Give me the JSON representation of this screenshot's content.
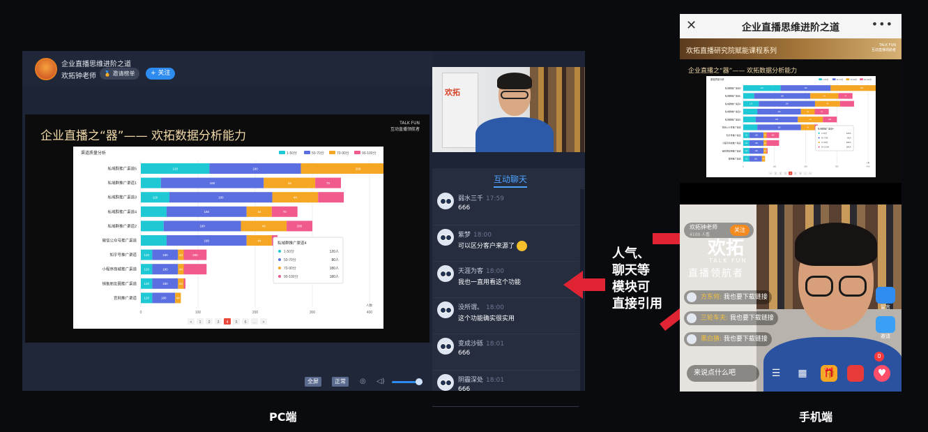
{
  "pc": {
    "course_title": "企业直播思维进阶之道",
    "teacher": "欢拓钟老师",
    "invite_label": "邀请榜单",
    "follow_label": "+ 关注",
    "slide_title": "企业直播之“器”—— 欢拓数据分析能力",
    "slide_logo_line1": "TALK FUN",
    "slide_logo_line2": "互动直播领航者",
    "controls": {
      "fullscreen": "全屏",
      "normal": "正常"
    },
    "chat_tab": "互动聊天",
    "chat": [
      {
        "name": "弱水三千",
        "time": "17:59",
        "text": "666"
      },
      {
        "name": "紫梦",
        "time": "18:00",
        "text": "可以区分客户来源了"
      },
      {
        "name": "天涯为客",
        "time": "18:00",
        "text": "我也一直用看这个功能"
      },
      {
        "name": "没所谓。",
        "time": "18:00",
        "text": "这个功能确实很实用"
      },
      {
        "name": "变成沙砾",
        "time": "18:01",
        "text": "666"
      },
      {
        "name": "阴霾深处",
        "time": "18:01",
        "text": "666"
      }
    ],
    "camera_logo": "欢拓"
  },
  "chart_data": {
    "type": "bar",
    "orientation": "horizontal",
    "stacked": true,
    "title": "渠道质量分析",
    "categories": [
      "私域群推广渠道5",
      "私域群推广渠道1",
      "私域群推广渠道3",
      "私域群推广渠道4",
      "私域群推广渠道2",
      "微信公众号推广渠道",
      "知乎号推广渠道",
      "小程序商城推广渠道",
      "销售朋友圈推广渠道",
      "官网推广渠道"
    ],
    "series": [
      {
        "name": "1-50分",
        "color": "#1ec8d4",
        "values": [
          120,
          35,
          50,
          45,
          40,
          45,
          20,
          20,
          20,
          20
        ],
        "labels": [
          "120",
          "",
          "120",
          "",
          "",
          "",
          "120",
          "120",
          "120",
          "120"
        ]
      },
      {
        "name": "50-70分",
        "color": "#5b6fe0",
        "values": [
          160,
          180,
          180,
          140,
          135,
          140,
          45,
          45,
          45,
          40
        ],
        "labels": [
          "180",
          "180",
          "180",
          "180",
          "180",
          "180",
          "180",
          "180",
          "180",
          "180"
        ]
      },
      {
        "name": "70-90分",
        "color": "#f5a623",
        "values": [
          200,
          90,
          80,
          44,
          80,
          44,
          10,
          10,
          10,
          10
        ],
        "labels": [
          "200",
          "44",
          "44",
          "44",
          "44",
          "44",
          "44",
          "44",
          "44",
          "44"
        ]
      },
      {
        "name": "90-100分",
        "color": "#f05a8c",
        "values": [
          90,
          45,
          45,
          45,
          45,
          10,
          40,
          40,
          3,
          0
        ],
        "labels": [
          "200",
          "70",
          "",
          "70",
          "280",
          "",
          "280",
          "",
          "",
          ""
        ]
      }
    ],
    "xlim": [
      0,
      400
    ],
    "xticks": [
      "0",
      "100",
      "200",
      "300",
      "400"
    ],
    "x_unit": "人数",
    "legend_position": "top-right",
    "tooltip": {
      "title": "私域群推广渠道4",
      "rows": [
        {
          "label": "1-50分",
          "value": "120人",
          "color": "#1ec8d4"
        },
        {
          "label": "50-70分",
          "value": "80人",
          "color": "#5b6fe0"
        },
        {
          "label": "70-90分",
          "value": "180人",
          "color": "#f5a623"
        },
        {
          "label": "90-100分",
          "value": "180人",
          "color": "#f05a8c"
        }
      ]
    },
    "pager": [
      "<",
      "1",
      "2",
      "3",
      "4",
      "5",
      "6",
      "...",
      ">"
    ],
    "active_page": "4"
  },
  "annotation": {
    "lines": [
      "人气、",
      "聊天等",
      "模块可",
      "直接引用"
    ],
    "arrow_color": "#e02433"
  },
  "mobile": {
    "title": "企业直播思维进阶之道",
    "banner": "欢拓直播研究院赋能课程系列",
    "banner_logo_line1": "TALK FUN",
    "banner_logo_line2": "互动直播领航者",
    "slide_title": "企业直播之“器”—— 欢拓数据分析能力",
    "host_name": "欢拓钟老师",
    "host_sub": "4100 人看",
    "follow": "关注",
    "logo_big": "欢拓",
    "logo_sub": "TALK FUN",
    "logo_slogan": "直播领航者",
    "chat": [
      {
        "name": "方东何:",
        "text": "我也要下载链接"
      },
      {
        "name": "三轮车夫:",
        "text": "我也要下载链接"
      },
      {
        "name": "黑白猜:",
        "text": "我也要下载链接"
      }
    ],
    "input_placeholder": "来说点什么吧",
    "side": {
      "note": "留言",
      "invite": "邀请"
    },
    "like_count": "0"
  },
  "captions": {
    "pc": "PC端",
    "mobile": "手机端"
  }
}
